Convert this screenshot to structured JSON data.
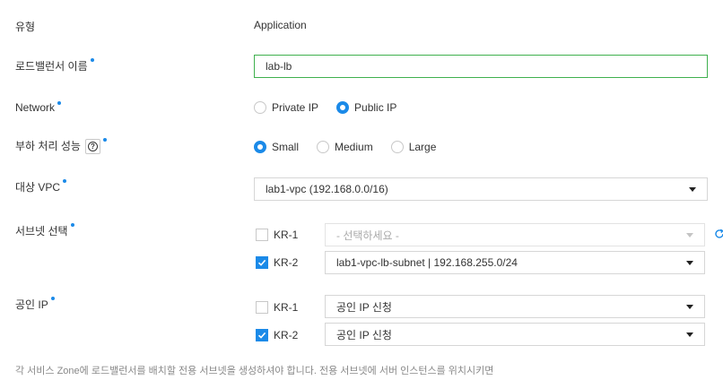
{
  "type_row": {
    "label": "유형",
    "value": "Application"
  },
  "name_row": {
    "label": "로드밸런서 이름",
    "value": "lab-lb"
  },
  "network_row": {
    "label": "Network",
    "options": [
      "Private IP",
      "Public IP"
    ],
    "selected": "Public IP"
  },
  "load_row": {
    "label": "부하 처리 성능",
    "help_icon": "question-icon",
    "options": [
      "Small",
      "Medium",
      "Large"
    ],
    "selected": "Small"
  },
  "vpc_row": {
    "label": "대상 VPC",
    "value": "lab1-vpc (192.168.0.0/16)"
  },
  "subnet_row": {
    "label": "서브넷 선택",
    "zones": [
      {
        "name": "KR-1",
        "checked": false,
        "value": "- 선택하세요 -",
        "disabled": true
      },
      {
        "name": "KR-2",
        "checked": true,
        "value": "lab1-vpc-lb-subnet | 192.168.255.0/24",
        "disabled": false
      }
    ],
    "refresh_icon": "refresh-icon"
  },
  "public_ip_row": {
    "label": "공인 IP",
    "zones": [
      {
        "name": "KR-1",
        "checked": false,
        "value": "공인 IP 신청"
      },
      {
        "name": "KR-2",
        "checked": true,
        "value": "공인 IP 신청"
      }
    ]
  },
  "note": "각 서비스 Zone에 로드밸런서를 배치할 전용 서브넷을 생성하셔야 합니다. 전용 서브넷에 서버 인스턴스를 위치시키면",
  "colors": {
    "accent": "#1b8ae8",
    "input_focus": "#3fb04e"
  }
}
